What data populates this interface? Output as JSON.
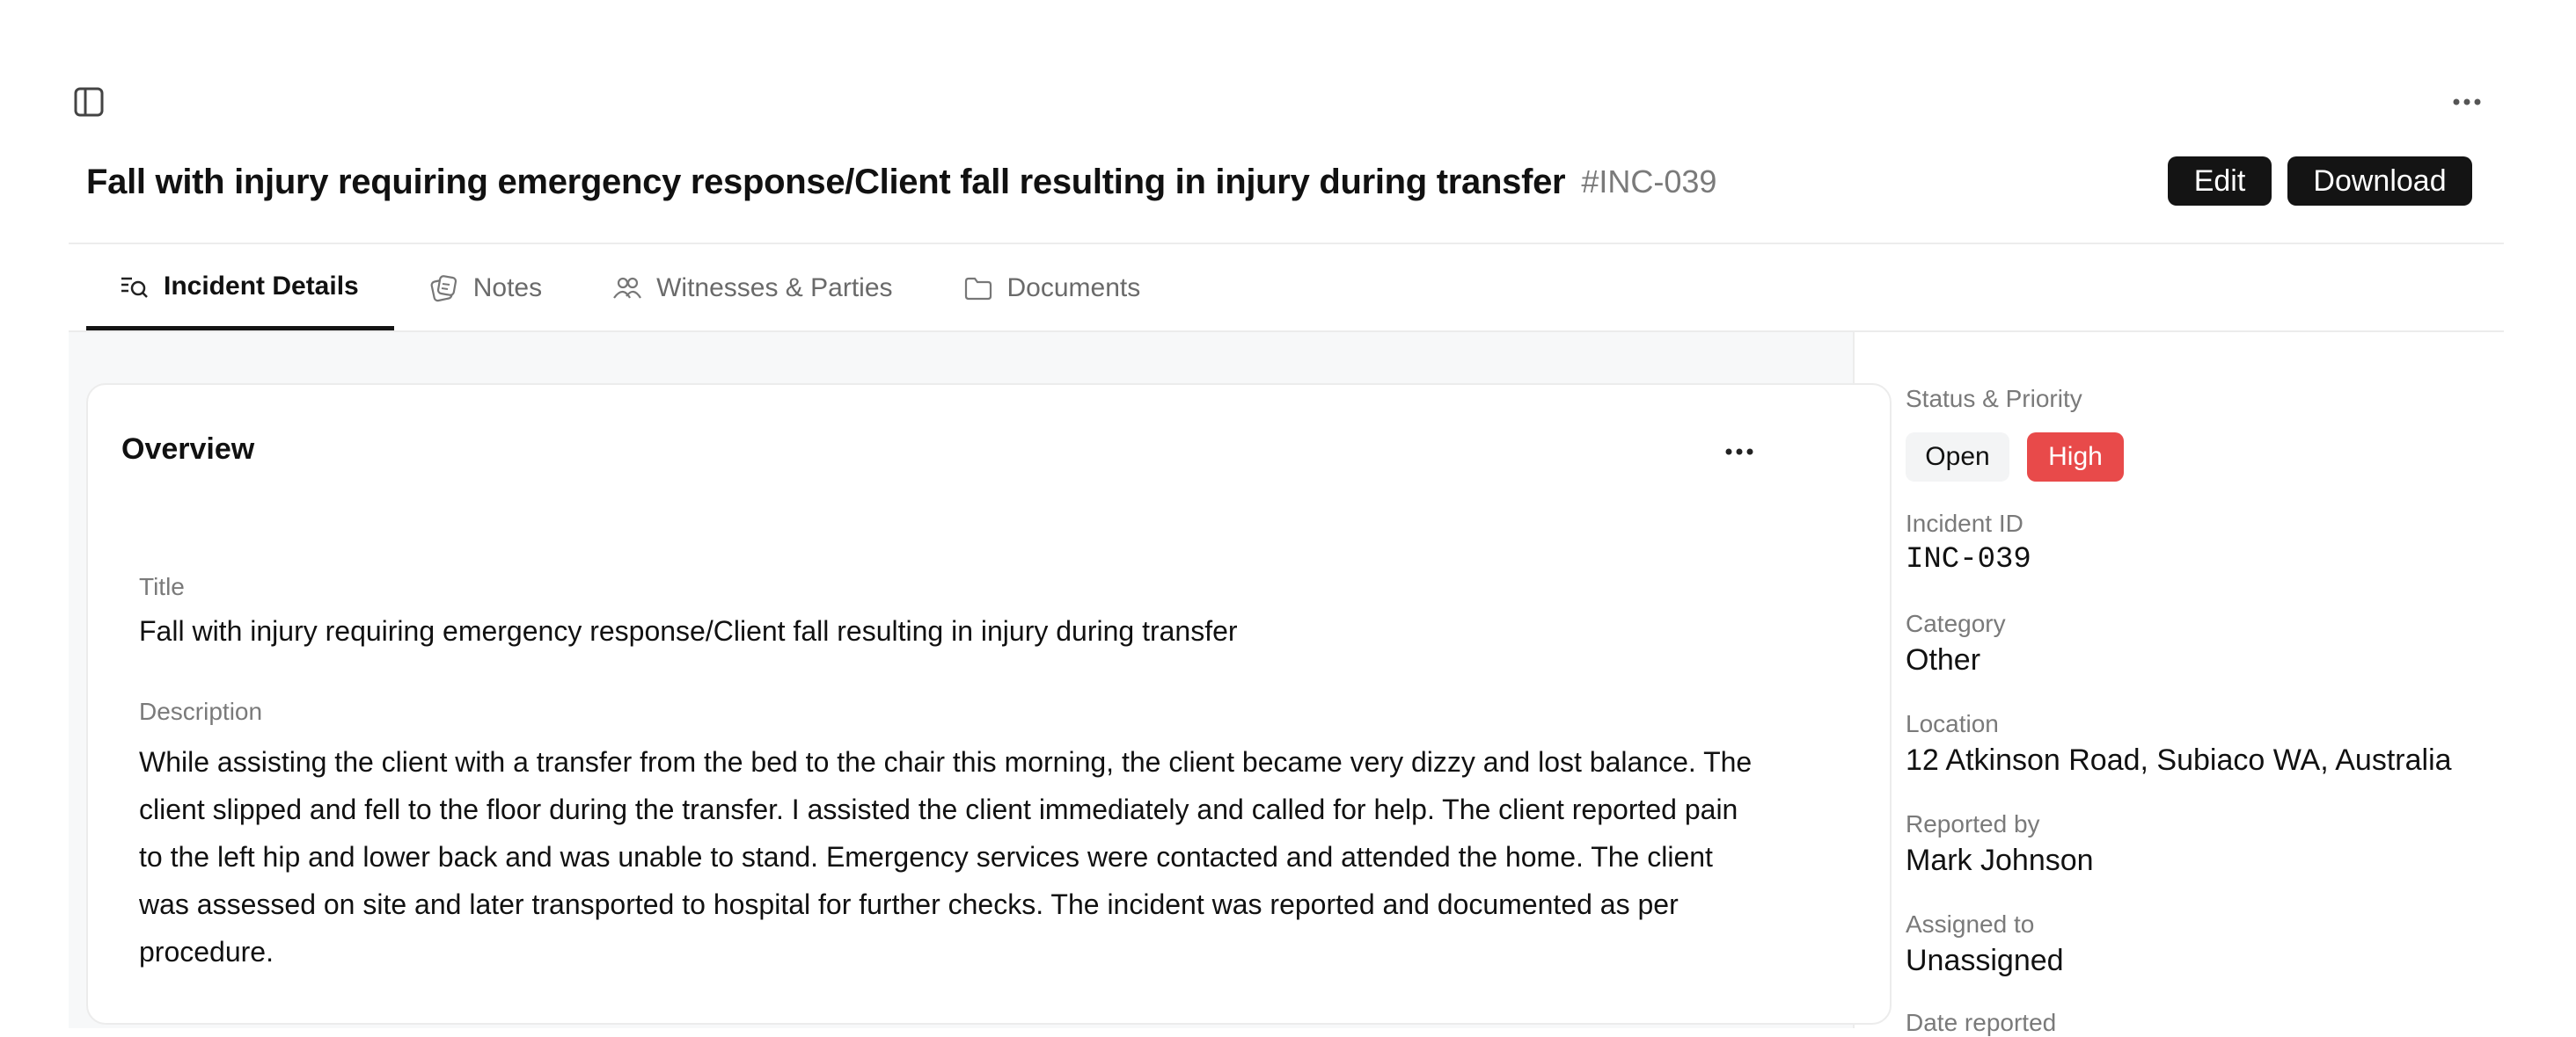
{
  "header": {
    "title": "Fall with injury requiring emergency response/Client fall resulting in injury during transfer",
    "incident_ref": "#INC-039",
    "edit_label": "Edit",
    "download_label": "Download"
  },
  "icons": {
    "sidebar_toggle": "sidebar-toggle-icon",
    "more": "more-horizontal-icon"
  },
  "tabs": [
    {
      "label": "Incident Details",
      "icon": "list-search-icon",
      "active": true
    },
    {
      "label": "Notes",
      "icon": "notes-icon",
      "active": false
    },
    {
      "label": "Witnesses & Parties",
      "icon": "users-icon",
      "active": false
    },
    {
      "label": "Documents",
      "icon": "folder-icon",
      "active": false
    }
  ],
  "overview": {
    "heading": "Overview",
    "title_label": "Title",
    "title_value": "Fall with injury requiring emergency response/Client fall resulting in injury during transfer",
    "description_label": "Description",
    "description_value": "While assisting the client with a transfer from the bed to the chair this morning, the client became very dizzy and lost balance. The client slipped and fell to the floor during the transfer. I assisted the client immediately and called for help. The client reported pain to the left hip and lower back and was unable to stand. Emergency services were contacted and attended the home. The client was assessed on site and later transported to hospital for further checks. The incident was reported and documented as per procedure."
  },
  "side_panel": {
    "status_label": "Status & Priority",
    "status": "Open",
    "priority": "High",
    "incident_id_label": "Incident ID",
    "incident_id": "INC-039",
    "category_label": "Category",
    "category": "Other",
    "location_label": "Location",
    "location": "12 Atkinson Road, Subiaco WA, Australia",
    "reported_by_label": "Reported by",
    "reported_by": "Mark Johnson",
    "assigned_to_label": "Assigned to",
    "assigned_to": "Unassigned",
    "date_reported_label": "Date reported"
  },
  "colors": {
    "button_bg": "#141414",
    "priority_high": "#e84a4a",
    "status_open_bg": "#f3f4f5",
    "muted_text": "#7a7a7a",
    "main_bg": "#f7f8f9"
  }
}
